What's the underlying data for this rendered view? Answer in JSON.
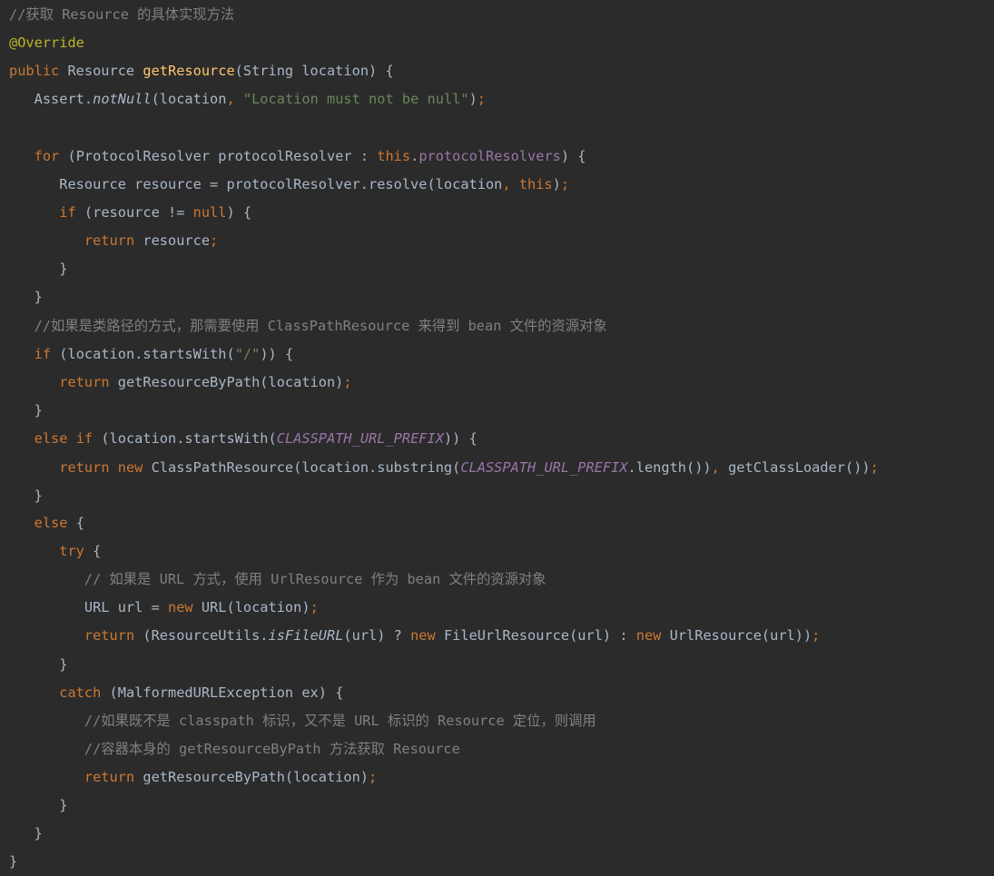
{
  "lines": [
    [
      {
        "t": "//获取 Resource 的具体实现方法",
        "c": "cmt"
      }
    ],
    [
      {
        "t": "@Override",
        "c": "ann"
      }
    ],
    [
      {
        "t": "public ",
        "c": "kw"
      },
      {
        "t": "Resource "
      },
      {
        "t": "getResource",
        "c": "fn"
      },
      {
        "t": "(String location) {"
      }
    ],
    [
      {
        "t": "   Assert."
      },
      {
        "t": "notNull",
        "c": "stat"
      },
      {
        "t": "(location"
      },
      {
        "t": ", ",
        "c": "punc"
      },
      {
        "t": "\"Location must not be null\"",
        "c": "str"
      },
      {
        "t": ")"
      },
      {
        "t": ";",
        "c": "punc"
      }
    ],
    [],
    [
      {
        "t": "   "
      },
      {
        "t": "for ",
        "c": "kw"
      },
      {
        "t": "(ProtocolResolver protocolResolver : "
      },
      {
        "t": "this",
        "c": "kw"
      },
      {
        "t": "."
      },
      {
        "t": "protocolResolvers",
        "c": "field"
      },
      {
        "t": ") {"
      }
    ],
    [
      {
        "t": "      Resource resource = protocolResolver.resolve(location"
      },
      {
        "t": ", ",
        "c": "punc"
      },
      {
        "t": "this",
        "c": "kw"
      },
      {
        "t": ")"
      },
      {
        "t": ";",
        "c": "punc"
      }
    ],
    [
      {
        "t": "      "
      },
      {
        "t": "if ",
        "c": "kw"
      },
      {
        "t": "(resource != "
      },
      {
        "t": "null",
        "c": "kw"
      },
      {
        "t": ") {"
      }
    ],
    [
      {
        "t": "         "
      },
      {
        "t": "return ",
        "c": "kw"
      },
      {
        "t": "resource"
      },
      {
        "t": ";",
        "c": "punc"
      }
    ],
    [
      {
        "t": "      }"
      }
    ],
    [
      {
        "t": "   }"
      }
    ],
    [
      {
        "t": "   //如果是类路径的方式，那需要使用 ClassPathResource 来得到 bean 文件的资源对象",
        "c": "cmt"
      }
    ],
    [
      {
        "t": "   "
      },
      {
        "t": "if ",
        "c": "kw"
      },
      {
        "t": "(location.startsWith("
      },
      {
        "t": "\"/\"",
        "c": "str"
      },
      {
        "t": ")) {"
      }
    ],
    [
      {
        "t": "      "
      },
      {
        "t": "return ",
        "c": "kw"
      },
      {
        "t": "getResourceByPath(location)"
      },
      {
        "t": ";",
        "c": "punc"
      }
    ],
    [
      {
        "t": "   }"
      }
    ],
    [
      {
        "t": "   "
      },
      {
        "t": "else if ",
        "c": "kw"
      },
      {
        "t": "(location.startsWith("
      },
      {
        "t": "CLASSPATH_URL_PREFIX",
        "c": "const"
      },
      {
        "t": ")) {"
      }
    ],
    [
      {
        "t": "      "
      },
      {
        "t": "return new ",
        "c": "kw"
      },
      {
        "t": "ClassPathResource(location.substring("
      },
      {
        "t": "CLASSPATH_URL_PREFIX",
        "c": "const"
      },
      {
        "t": ".length())"
      },
      {
        "t": ", ",
        "c": "punc"
      },
      {
        "t": "getClassLoader())"
      },
      {
        "t": ";",
        "c": "punc"
      }
    ],
    [
      {
        "t": "   }"
      }
    ],
    [
      {
        "t": "   "
      },
      {
        "t": "else ",
        "c": "kw"
      },
      {
        "t": "{"
      }
    ],
    [
      {
        "t": "      "
      },
      {
        "t": "try ",
        "c": "kw"
      },
      {
        "t": "{"
      }
    ],
    [
      {
        "t": "         // 如果是 URL 方式，使用 UrlResource 作为 bean 文件的资源对象",
        "c": "cmt"
      }
    ],
    [
      {
        "t": "         URL url = "
      },
      {
        "t": "new ",
        "c": "kw"
      },
      {
        "t": "URL(location)"
      },
      {
        "t": ";",
        "c": "punc"
      }
    ],
    [
      {
        "t": "         "
      },
      {
        "t": "return ",
        "c": "kw"
      },
      {
        "t": "(ResourceUtils."
      },
      {
        "t": "isFileURL",
        "c": "stat"
      },
      {
        "t": "(url) ? "
      },
      {
        "t": "new ",
        "c": "kw"
      },
      {
        "t": "FileUrlResource(url) : "
      },
      {
        "t": "new ",
        "c": "kw"
      },
      {
        "t": "UrlResource(url))"
      },
      {
        "t": ";",
        "c": "punc"
      }
    ],
    [
      {
        "t": "      }"
      }
    ],
    [
      {
        "t": "      "
      },
      {
        "t": "catch ",
        "c": "kw"
      },
      {
        "t": "(MalformedURLException ex) {"
      }
    ],
    [
      {
        "t": "         //如果既不是 classpath 标识，又不是 URL 标识的 Resource 定位，则调用",
        "c": "cmt"
      }
    ],
    [
      {
        "t": "         //容器本身的 getResourceByPath 方法获取 Resource",
        "c": "cmt"
      }
    ],
    [
      {
        "t": "         "
      },
      {
        "t": "return ",
        "c": "kw"
      },
      {
        "t": "getResourceByPath(location)"
      },
      {
        "t": ";",
        "c": "punc"
      }
    ],
    [
      {
        "t": "      }"
      }
    ],
    [
      {
        "t": "   }"
      }
    ],
    [
      {
        "t": "}"
      }
    ]
  ]
}
